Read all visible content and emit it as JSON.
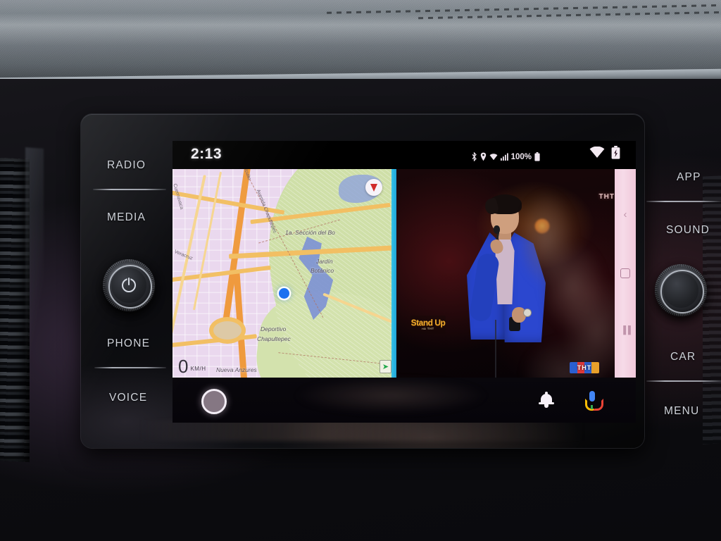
{
  "screen": {
    "clock": "2:13",
    "status": {
      "bluetooth_icon": "bluetooth-icon",
      "location_icon": "location-pin-icon",
      "wifi_small_icon": "wifi-icon",
      "signal_icon": "cellular-signal-icon",
      "battery_percent": "100%",
      "battery_icon": "battery-icon",
      "wifi_large_icon": "wifi-icon",
      "battery_charging_icon": "battery-charging-icon"
    },
    "map": {
      "speed_value": "0",
      "speed_unit": "KM/H",
      "compass_icon": "compass-needle-icon",
      "street_labels": [
        "Cuernavaca",
        "Veracruz",
        "Circuito",
        "Avenida Chapultepec"
      ],
      "place_labels": [
        "1a. Sección del Bo",
        "Jardín",
        "Botánico",
        "Deportivo",
        "Chapultepec",
        "Nueva Anzures"
      ],
      "current_location_icon": "blue-location-dot",
      "corner_badge_icon": "green-navigation-icon"
    },
    "video": {
      "channel_logo_top": "ТНТ",
      "channel_bug_bottom": "ТНТ",
      "show_logo_line1": "Stand Up",
      "show_logo_line2": "на ТНТ",
      "performer_icon": "performer-with-microphone"
    },
    "sidenav": {
      "back_icon": "chevron-left-icon",
      "home_icon": "home-square-icon",
      "recents_icon": "recents-icon"
    },
    "appbar": {
      "home_icon": "android-auto-home-ring-icon",
      "notifications_icon": "bell-icon",
      "assistant_icon": "google-assistant-mic-icon"
    }
  },
  "controls": {
    "left": {
      "radio_label": "RADIO",
      "media_label": "MEDIA",
      "phone_label": "PHONE",
      "voice_label": "VOICE",
      "knob_icon": "power-volume-knob"
    },
    "right": {
      "app_label": "APP",
      "sound_label": "SOUND",
      "car_label": "CAR",
      "menu_label": "MENU",
      "knob_icon": "tuning-knob"
    }
  }
}
